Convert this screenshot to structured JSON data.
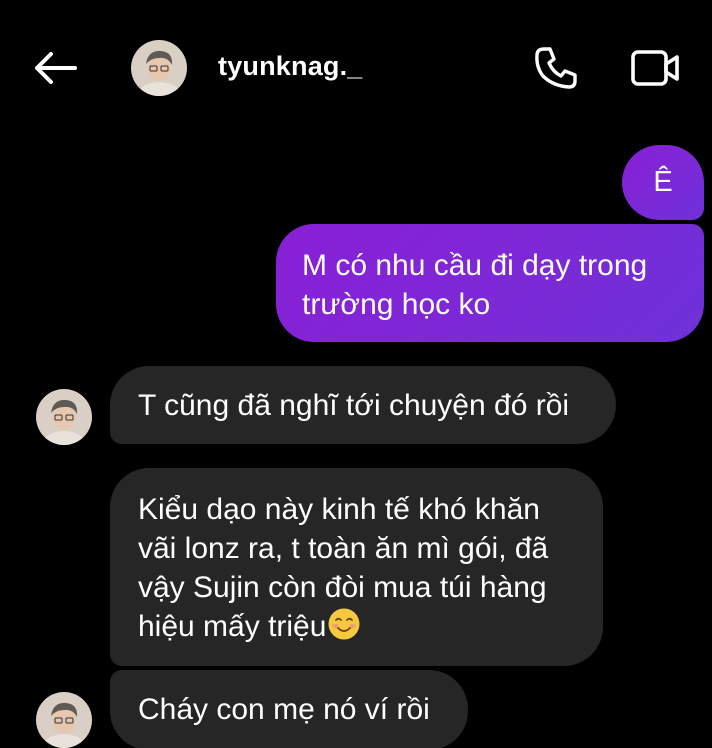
{
  "header": {
    "username": "tyunknag._",
    "icons": {
      "back": "back-arrow-icon",
      "call": "phone-icon",
      "video": "video-camera-icon"
    }
  },
  "messages": [
    {
      "direction": "outgoing",
      "lines": [
        "Ê"
      ]
    },
    {
      "direction": "outgoing",
      "lines": [
        "M có nhu cầu đi dạy trong",
        "trường học ko"
      ]
    },
    {
      "direction": "incoming",
      "lines": [
        "T cũng đã nghĩ tới chuyện đó rồi"
      ]
    },
    {
      "direction": "incoming",
      "lines": [
        "Kiểu dạo này kinh tế khó khăn",
        "vãi lonz ra, t toàn ăn mì gói, đã",
        "vậy Sujin còn đòi mua túi hàng",
        "hiệu mấy triệu"
      ],
      "emoji": "smiling-face-emoji"
    },
    {
      "direction": "incoming",
      "lines": [
        "Cháy con mẹ nó ví rồi"
      ]
    }
  ],
  "colors": {
    "background": "#000000",
    "outgoing_bubble": "#8a1fd6",
    "incoming_bubble": "#262626",
    "text": "#ffffff"
  }
}
